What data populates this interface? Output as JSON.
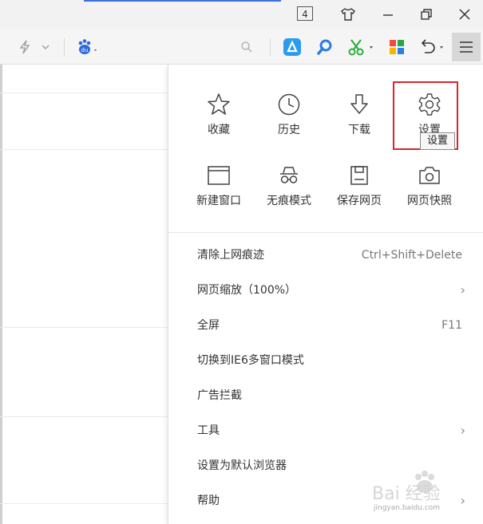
{
  "titlebar": {
    "tab_count": "4"
  },
  "menu": {
    "grid": [
      {
        "label": "收藏",
        "icon": "star-icon"
      },
      {
        "label": "历史",
        "icon": "clock-icon"
      },
      {
        "label": "下载",
        "icon": "download-icon"
      },
      {
        "label": "设置",
        "icon": "gear-icon"
      },
      {
        "label": "新建窗口",
        "icon": "new-window-icon"
      },
      {
        "label": "无痕模式",
        "icon": "incognito-icon"
      },
      {
        "label": "保存网页",
        "icon": "save-icon"
      },
      {
        "label": "网页快照",
        "icon": "camera-icon"
      }
    ],
    "tooltip": "设置",
    "items": [
      {
        "label": "清除上网痕迹",
        "shortcut": "Ctrl+Shift+Delete"
      },
      {
        "label": "网页缩放（100%）",
        "arrow": "›"
      },
      {
        "label": "全屏",
        "shortcut": "F11"
      },
      {
        "label": "切换到IE6多窗口模式"
      },
      {
        "label": "广告拦截"
      },
      {
        "label": "工具",
        "arrow": "›"
      },
      {
        "label": "设置为默认浏览器"
      },
      {
        "label": "帮助",
        "arrow": "›"
      }
    ]
  },
  "watermark": {
    "text": "Bai 经验",
    "url_text": "jingyan.baidu.com"
  },
  "colors": {
    "highlight": "#d9252b",
    "accent": "#3c6fd8"
  }
}
